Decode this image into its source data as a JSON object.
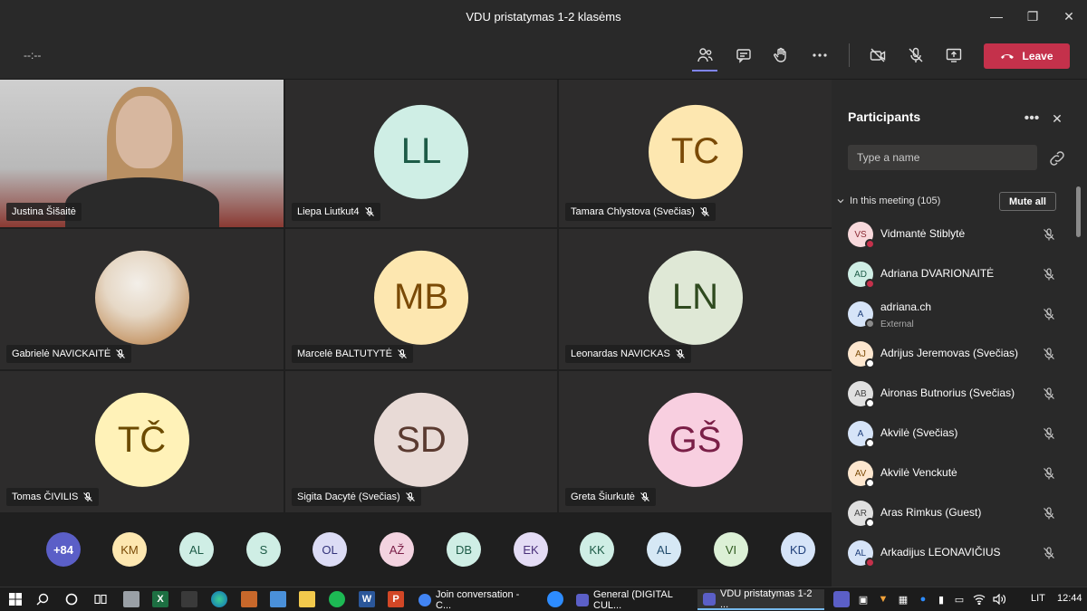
{
  "window": {
    "title": "VDU pristatymas 1-2 klasėms"
  },
  "toolbar": {
    "timer": "--:--",
    "leave_label": "Leave"
  },
  "tiles": [
    {
      "name": "Justina Šišaitė",
      "type": "video",
      "muted": false
    },
    {
      "name": "Liepa Liutkut4",
      "initials": "LL",
      "bg": "#cfeee5",
      "fg": "#1d5b47",
      "muted": true
    },
    {
      "name": "Tamara Chlystova (Svečias)",
      "initials": "TC",
      "bg": "#fde7b0",
      "fg": "#7a4a06",
      "muted": true
    },
    {
      "name": "Gabrielė NAVICKAITĖ",
      "type": "image",
      "muted": true
    },
    {
      "name": "Marcelė BALTUTYTĖ",
      "initials": "MB",
      "bg": "#fde7b0",
      "fg": "#7a4a06",
      "muted": true
    },
    {
      "name": "Leonardas NAVICKAS",
      "initials": "LN",
      "bg": "#dfe8d6",
      "fg": "#2f4a1f",
      "muted": true
    },
    {
      "name": "Tomas ČIVILIS",
      "initials": "TČ",
      "bg": "#fff2b8",
      "fg": "#6b4a00",
      "muted": true
    },
    {
      "name": "Sigita Dacytė (Svečias)",
      "initials": "SD",
      "bg": "#e8dad6",
      "fg": "#5a3a30",
      "muted": true
    },
    {
      "name": "Greta Šiurkutė",
      "initials": "GŠ",
      "bg": "#f8cfe0",
      "fg": "#7a1f47",
      "muted": true
    }
  ],
  "strip": {
    "overflow": "+84",
    "avatars": [
      {
        "initials": "KM",
        "bg": "#fde7b0",
        "fg": "#7a4a06"
      },
      {
        "initials": "AL",
        "bg": "#cfeee5",
        "fg": "#1d5b47"
      },
      {
        "initials": "S",
        "bg": "#cfeee5",
        "fg": "#1d5b47"
      },
      {
        "initials": "OL",
        "bg": "#dcdcf5",
        "fg": "#33337a"
      },
      {
        "initials": "AŽ",
        "bg": "#f3d3e0",
        "fg": "#7a1f47"
      },
      {
        "initials": "DB",
        "bg": "#cfeee5",
        "fg": "#1d5b47"
      },
      {
        "initials": "EK",
        "bg": "#e4dcf5",
        "fg": "#4a307a"
      },
      {
        "initials": "KK",
        "bg": "#cfeee5",
        "fg": "#1d5b47"
      },
      {
        "initials": "AL",
        "bg": "#d6e8f5",
        "fg": "#1f4a6b"
      },
      {
        "initials": "VI",
        "bg": "#dcf0d6",
        "fg": "#2f5a1f"
      },
      {
        "initials": "KD",
        "bg": "#d6e4f8",
        "fg": "#1f3f7a"
      }
    ]
  },
  "panel": {
    "title": "Participants",
    "search_placeholder": "Type a name",
    "section_label": "In this meeting (105)",
    "mute_all_label": "Mute all",
    "participants": [
      {
        "initials": "VS",
        "name": "Vidmantė Stiblytė",
        "bg": "#f8d9dc",
        "fg": "#8a2a33",
        "status": "#c4314b"
      },
      {
        "initials": "AD",
        "name": "Adriana DVARIONAITĖ",
        "bg": "#cfeee5",
        "fg": "#1d5b47",
        "status": "#c4314b"
      },
      {
        "initials": "A",
        "name": "adriana.ch",
        "sub": "External",
        "bg": "#d6e4f8",
        "fg": "#1f3f7a",
        "status": "#8a8a8a"
      },
      {
        "initials": "AJ",
        "name": "Adrijus Jeremovas (Svečias)",
        "bg": "#fde7cf",
        "fg": "#7a4a06",
        "status": "#ffffff"
      },
      {
        "initials": "AB",
        "name": "Aironas Butnorius (Svečias)",
        "bg": "#e0e0e0",
        "fg": "#444444",
        "status": "#ffffff"
      },
      {
        "initials": "A",
        "name": "Akvilė (Svečias)",
        "bg": "#d6e4f8",
        "fg": "#1f3f7a",
        "status": "#ffffff"
      },
      {
        "initials": "AV",
        "name": "Akvilė Venckutė",
        "bg": "#fde7cf",
        "fg": "#7a4a06",
        "status": "#ffffff"
      },
      {
        "initials": "AR",
        "name": "Aras Rimkus (Guest)",
        "bg": "#e0e0e0",
        "fg": "#444444",
        "status": "#ffffff"
      },
      {
        "initials": "AL",
        "name": "Arkadijus LEONAVIČIUS",
        "bg": "#d6e4f8",
        "fg": "#1f3f7a",
        "status": "#c4314b"
      }
    ]
  },
  "taskbar": {
    "apps": [
      {
        "label": "Join conversation - C...",
        "color": "#4285f4",
        "active": false
      },
      {
        "label": "General (DIGITAL CUL...",
        "color": "#5b5fc7",
        "active": false
      },
      {
        "label": "VDU pristatymas 1-2 ...",
        "color": "#5b5fc7",
        "active": true
      }
    ],
    "lang": "LIT",
    "time": "12:44"
  }
}
